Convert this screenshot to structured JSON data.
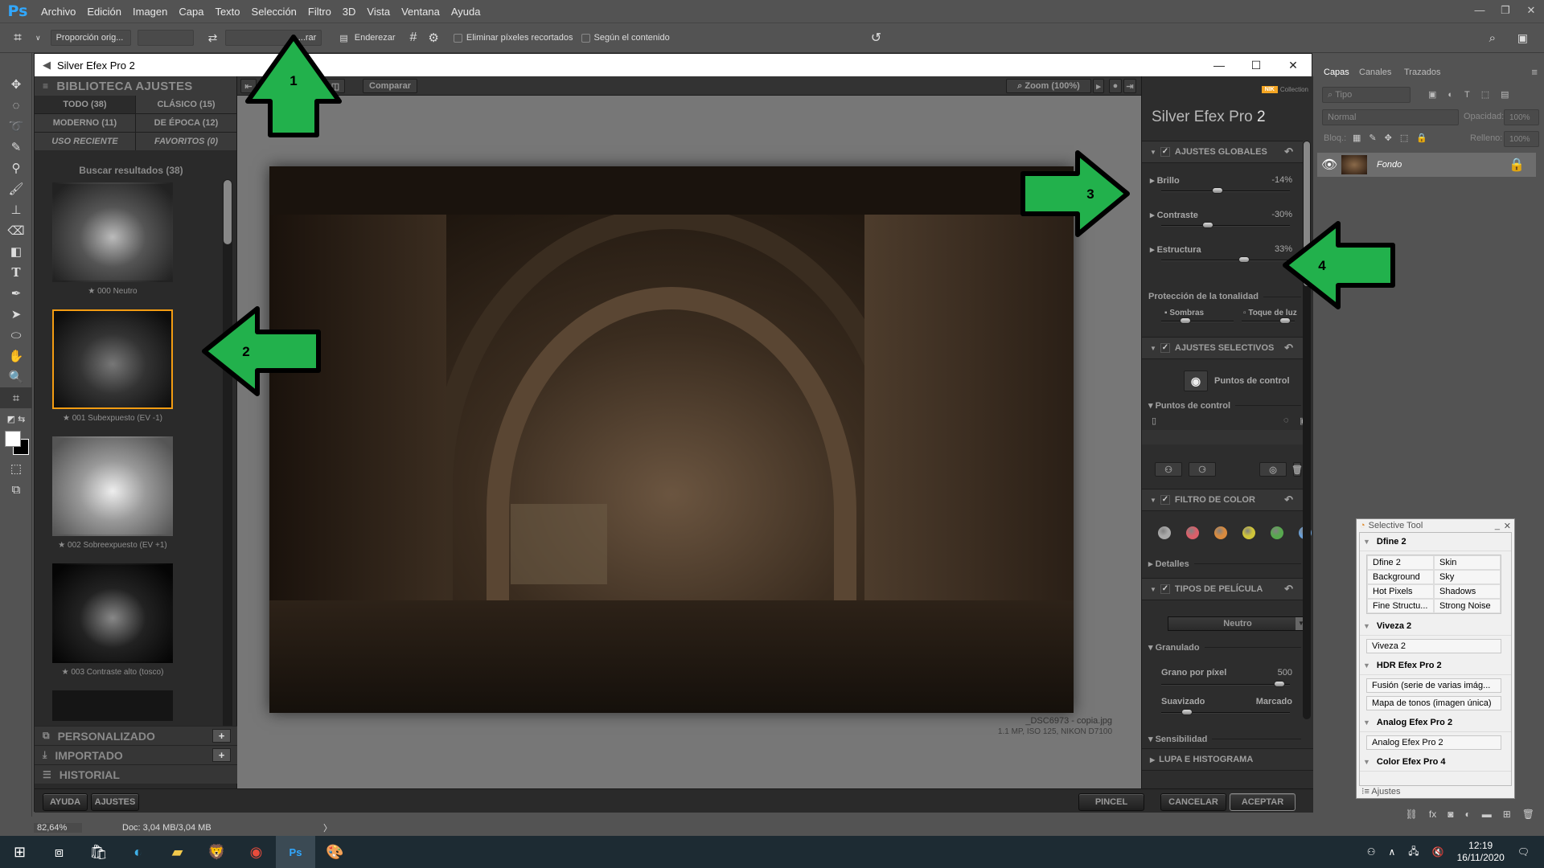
{
  "app": {
    "logo": "Ps",
    "menu": [
      "Archivo",
      "Edición",
      "Imagen",
      "Capa",
      "Texto",
      "Selección",
      "Filtro",
      "3D",
      "Vista",
      "Ventana",
      "Ayuda"
    ]
  },
  "options_bar": {
    "ratio": "Proporción orig...",
    "straighten": "Enderezar",
    "clear_label": "...rar",
    "delete_cropped": "Eliminar píxeles recortados",
    "content_aware": "Según el contenido"
  },
  "dialog": {
    "title": "Silver Efex Pro 2",
    "library": {
      "title": "BIBLIOTECA AJUSTES",
      "filters": [
        {
          "label": "TODO (38)",
          "selected": true
        },
        {
          "label": "CLÁSICO (15)"
        },
        {
          "label": "MODERNO (11)"
        },
        {
          "label": "DE ÉPOCA (12)"
        },
        {
          "label": "USO RECIENTE"
        },
        {
          "label": "FAVORITOS (0)"
        }
      ],
      "results_title": "Buscar resultados (38)",
      "presets": [
        {
          "label": "★ 000 Neutro",
          "selected": false
        },
        {
          "label": "★ 001 Subexpuesto (EV -1)",
          "selected": true
        },
        {
          "label": "★ 002 Sobreexpuesto (EV +1)",
          "selected": false
        },
        {
          "label": "★ 003 Contraste alto (tosco)",
          "selected": false
        }
      ],
      "sections": [
        "PERSONALIZADO",
        "IMPORTADO",
        "HISTORIAL"
      ]
    },
    "center": {
      "compare": "Comparar",
      "zoom": "Zoom (100%)",
      "file_name": "_DSC6973 - copia.jpg",
      "file_meta": "1.1 MP, ISO 125, NIKON D7100"
    },
    "settings": {
      "brand": "Collection",
      "brand_badge": "NIK",
      "title_main": "Silver Efex Pro",
      "title_num": "2",
      "global": {
        "title": "AJUSTES GLOBALES",
        "sliders": [
          {
            "label": "Brillo",
            "value": "-14%",
            "fraction": 0.43
          },
          {
            "label": "Contraste",
            "value": "-30%",
            "fraction": 0.35
          },
          {
            "label": "Estructura",
            "value": "33%",
            "fraction": 0.66
          }
        ],
        "tonal_title": "Protección de la tonalidad",
        "shadows": "Sombras",
        "highlights": "Toque de luz",
        "shadows_fraction": 0.3,
        "highlights_fraction": 0.9
      },
      "selective": {
        "title": "AJUSTES SELECTIVOS",
        "control_points_btn": "Puntos de control",
        "control_points_sub": "Puntos de control"
      },
      "color_filter": {
        "title": "FILTRO DE COLOR",
        "colors": [
          "#a9a9a9",
          "#d9606a",
          "#d98b3f",
          "#cfc43a",
          "#58a84f",
          "#6a9fd6"
        ],
        "details": "Detalles"
      },
      "film": {
        "title": "TIPOS DE PELÍCULA",
        "type": "Neutro",
        "grain": "Granulado",
        "grain_per_pixel": "Grano por píxel",
        "grain_value": "500",
        "grain_fraction": 0.96,
        "soft": "Suavizado",
        "hard": "Marcado",
        "soft_fraction": 0.17,
        "sensitivity": "Sensibilidad"
      },
      "loupe": "LUPA E HISTOGRAMA"
    },
    "bottom": {
      "help": "AYUDA",
      "settings": "AJUSTES",
      "brush": "PINCEL",
      "cancel": "CANCELAR",
      "accept": "ACEPTAR"
    }
  },
  "status": {
    "zoom": "82,64%",
    "doc": "Doc: 3,04 MB/3,04 MB"
  },
  "layers_panel": {
    "tabs": [
      "Capas",
      "Canales",
      "Trazados"
    ],
    "kind": "Tipo",
    "blend": "Normal",
    "opacity_label": "Opacidad:",
    "opacity": "100%",
    "lock_label": "Bloq.:",
    "fill_label": "Relleno:",
    "fill": "100%",
    "layer_name": "Fondo"
  },
  "selective_tool": {
    "title": "Selective Tool",
    "groups": [
      {
        "name": "Dfine 2",
        "items": [
          "Dfine 2",
          "Skin",
          "Background",
          "Sky",
          "Hot Pixels",
          "Shadows",
          "Fine Structu...",
          "Strong Noise"
        ],
        "grid": true
      },
      {
        "name": "Viveza 2",
        "items": [
          "Viveza 2"
        ]
      },
      {
        "name": "HDR Efex Pro 2",
        "items": [
          "Fusión (serie de varias imág...",
          "Mapa de tonos (imagen única)"
        ]
      },
      {
        "name": "Analog Efex Pro 2",
        "items": [
          "Analog Efex Pro 2"
        ]
      },
      {
        "name": "Color Efex Pro 4",
        "items": []
      }
    ],
    "footer_tab": "Ajustes"
  },
  "annotations": [
    "1",
    "2",
    "3",
    "4"
  ],
  "taskbar": {
    "time": "12:19",
    "date": "16/11/2020"
  }
}
